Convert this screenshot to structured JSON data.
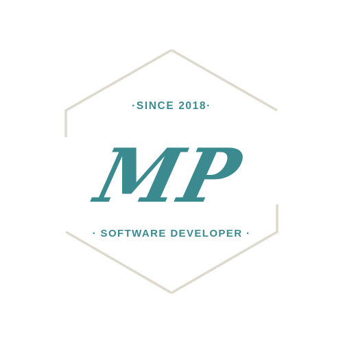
{
  "colors": {
    "frame": "#ded9cd",
    "accent": "#3a8a8f",
    "background": "#ffffff"
  },
  "badge": {
    "top_text": "·SINCE 2018·",
    "monogram": "MP",
    "bottom_text": "· SOFTWARE DEVELOPER ·"
  }
}
